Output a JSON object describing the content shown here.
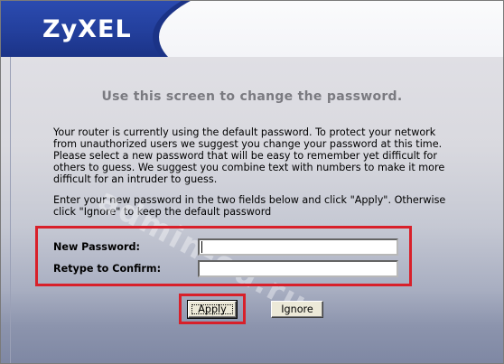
{
  "header": {
    "logo_text": "ZyXEL"
  },
  "watermark": {
    "text": "admin-ou.ru"
  },
  "main": {
    "title": "Use this screen to change the password.",
    "paragraph1": "Your router is currently using the default password. To protect your network from unauthorized users we suggest you change your password at this time. Please select a new password that will be easy to remember yet difficult for others to guess. We suggest you combine text with numbers to make it more difficult for an intruder to guess.",
    "paragraph2": "Enter your new password in the two fields below and click \"Apply\". Otherwise click \"Ignore\" to keep the default password"
  },
  "form": {
    "new_password_label": "New Password:",
    "new_password_value": "",
    "retype_label": "Retype to Confirm:",
    "retype_value": ""
  },
  "buttons": {
    "apply_label": "Apply",
    "ignore_label": "Ignore"
  },
  "colors": {
    "header_blue": "#233f9c",
    "highlight_red": "#d8202a",
    "title_gray": "#7a7a80"
  }
}
